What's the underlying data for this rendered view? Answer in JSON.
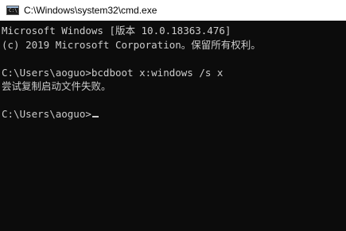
{
  "window": {
    "title": "C:\\Windows\\system32\\cmd.exe",
    "icon": "cmd-icon"
  },
  "console": {
    "lines": [
      "Microsoft Windows [版本 10.0.18363.476]",
      "(c) 2019 Microsoft Corporation。保留所有权利。",
      "",
      "C:\\Users\\aoguo>bcdboot x:windows /s x",
      "尝试复制启动文件失败。",
      ""
    ],
    "prompt": "C:\\Users\\aoguo>",
    "input": ""
  },
  "colors": {
    "background": "#0c0c0c",
    "text": "#cccccc",
    "titlebar": "#ffffff"
  }
}
